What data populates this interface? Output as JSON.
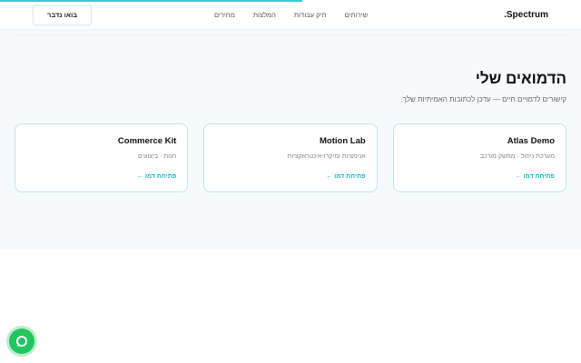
{
  "page_progress_percent": 52,
  "header": {
    "logo": "Spectrum.",
    "nav": [
      "שירותים",
      "תיק עבודות",
      "המלצות",
      "מחירים"
    ],
    "cta": "בואו נדבר"
  },
  "main": {
    "title": "הדמואים שלי",
    "subtitle": "קישורים לדמויים חיים — עדכן לכתובות האמיתיות שלך.",
    "cards": [
      {
        "title": "Atlas Demo",
        "desc": "מערכת ניהול · ממשק מורכב",
        "link": "פתיחת דמו ←"
      },
      {
        "title": "Motion Lab",
        "desc": "אנימציות ומיקרו-אינטראקציות",
        "link": "פתיחת דמו ←"
      },
      {
        "title": "Commerce Kit",
        "desc": "חנות · ביצועים",
        "link": "פתיחת דמו ←"
      }
    ]
  },
  "chat_icon": "chat-bubble-icon"
}
